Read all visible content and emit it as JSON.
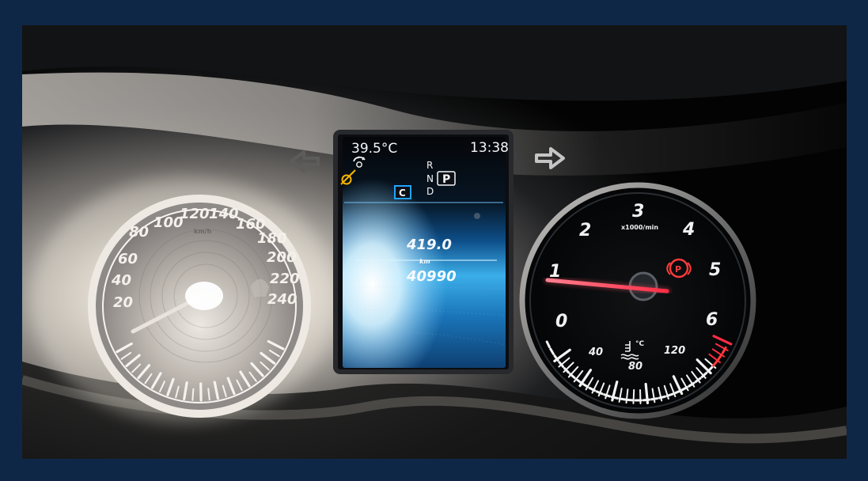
{
  "cluster": {
    "outside_temperature": "39.5°C",
    "clock": "13:38",
    "gear_positions": [
      "R",
      "N",
      "D"
    ],
    "gear_selected": "P",
    "cruise_mode": "C",
    "trip_distance": "419.0",
    "distance_unit": "km",
    "odometer": "40990"
  },
  "speedometer": {
    "unit": "km/h",
    "labels": [
      "20",
      "40",
      "60",
      "80",
      "100",
      "120",
      "140",
      "160",
      "180",
      "200",
      "220",
      "240"
    ]
  },
  "tachometer": {
    "unit": "x1000/min",
    "labels": [
      "0",
      "1",
      "2",
      "3",
      "4",
      "5",
      "6"
    ],
    "needle_rpm_thousands": 1.0
  },
  "coolant_gauge": {
    "labels": [
      "40",
      "80",
      "120"
    ],
    "unit": "°C"
  },
  "indicators": {
    "left_turn_icon": "left-arrow-icon",
    "right_turn_icon": "right-arrow-icon",
    "seatbelt_icon": "seatbelt-warning-icon",
    "parking_brake_icon": "parking-brake-icon",
    "coolant_icon": "coolant-temperature-icon"
  },
  "colors": {
    "frame_border": "#0f2747",
    "needle": "#ff2345",
    "parking_brake": "#ff3b3b",
    "seatbelt_warning": "#f4b400",
    "display_blue": "#39a9ff",
    "cruise_box": "#22a4ff"
  }
}
